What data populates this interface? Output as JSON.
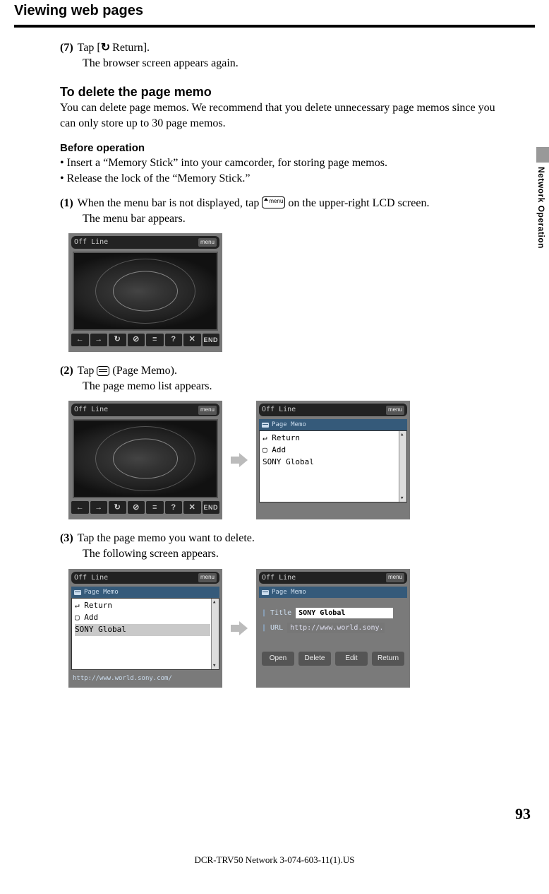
{
  "page_title": "Viewing web pages",
  "step7": {
    "num": "(7)",
    "line1a": "Tap [",
    "glyph": "↻",
    "line1b": " Return].",
    "line2": "The browser screen appears again."
  },
  "section_delete_head": "To delete the page memo",
  "section_delete_body": "You can delete page memos. We recommend that you delete unnecessary page memos since you can only store up to 30 page memos.",
  "before_op_head": "Before operation",
  "before_op_bullets": [
    "Insert a “Memory Stick” into your camcorder, for storing page memos.",
    "Release the lock of the “Memory Stick.”"
  ],
  "step1": {
    "num": "(1)",
    "part1": "When the menu bar is not displayed, tap ",
    "icon_label": "menu",
    "part2": " on the upper-right LCD screen.",
    "line2": "The menu bar appears."
  },
  "step2": {
    "num": "(2)",
    "part1": "Tap ",
    "part2": " (Page Memo).",
    "line2": "The page memo list appears."
  },
  "step3": {
    "num": "(3)",
    "line1": "Tap the page memo you want to delete.",
    "line2": "The following screen appears."
  },
  "lcd": {
    "status": "Off Line",
    "menu_btn": "menu",
    "toolbar": [
      "←",
      "→",
      "↻",
      "⊘",
      "≡",
      "?",
      "✕",
      "END"
    ],
    "page_memo_label": "Page Memo",
    "entries": {
      "return": "↵ Return",
      "add": "▢ Add",
      "sony": "SONY Global"
    },
    "status_url": "http://www.world.sony.com/",
    "detail": {
      "title_label": "Title",
      "title_value": "SONY Global",
      "url_label": "URL",
      "url_value": "http://www.world.sony.com/",
      "buttons": [
        "Open",
        "Delete",
        "Edit",
        "Return"
      ]
    }
  },
  "side_tab": "Network Operation",
  "page_number": "93",
  "footer": "DCR-TRV50 Network 3-074-603-11(1).US"
}
